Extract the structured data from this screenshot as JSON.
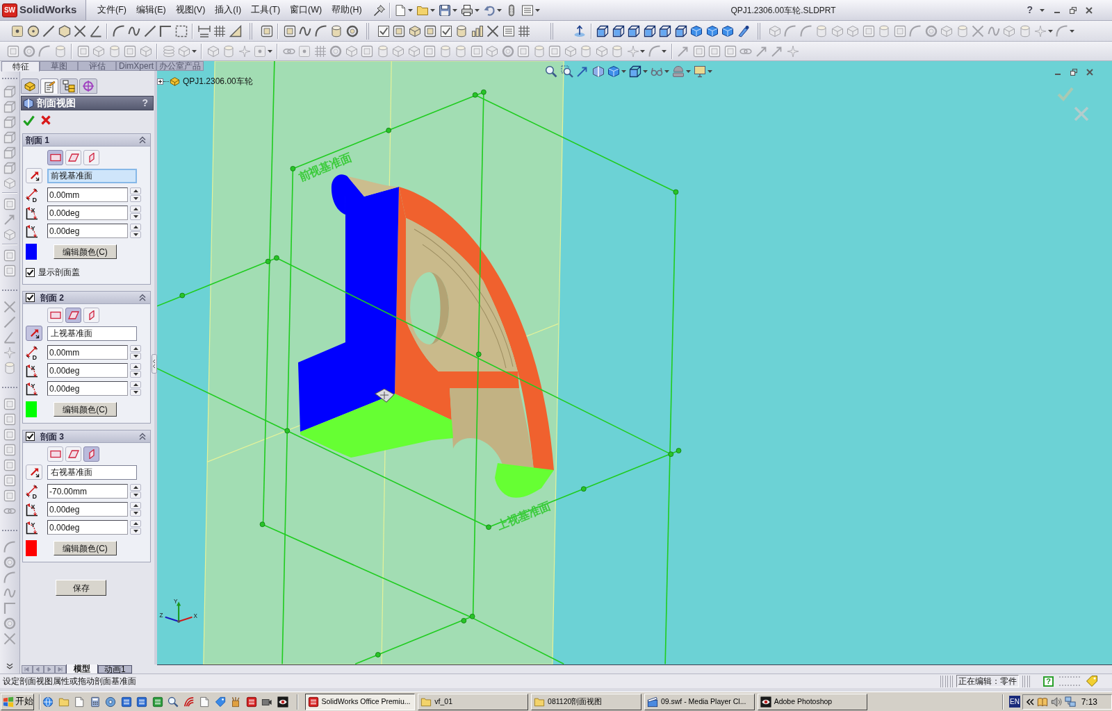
{
  "title_bar": {
    "logo_mark": "SW",
    "app_name": "SolidWorks",
    "menus": [
      "文件(F)",
      "编辑(E)",
      "视图(V)",
      "插入(I)",
      "工具(T)",
      "窗口(W)",
      "帮助(H)"
    ],
    "document_title": "QPJ1.2306.00车轮.SLDPRT",
    "help": "?"
  },
  "command_tabs": [
    {
      "label": "特征",
      "selected": true
    },
    {
      "label": "草图",
      "selected": false
    },
    {
      "label": "评估",
      "selected": false
    },
    {
      "label": "DimXpert",
      "selected": false
    },
    {
      "label": "办公室产品",
      "selected": false
    }
  ],
  "manager_tabs": [
    {
      "kind": "feature_tree",
      "selected": false
    },
    {
      "kind": "properties",
      "selected": true
    },
    {
      "kind": "configurations",
      "selected": false
    },
    {
      "kind": "dimxpert",
      "selected": false
    }
  ],
  "property_manager": {
    "title": "剖面视图",
    "help": "?",
    "sections": [
      {
        "kind": "plain",
        "title": "剖面 1",
        "planes": [
          {
            "kind": "front",
            "selected": true
          },
          {
            "kind": "top",
            "selected": false
          },
          {
            "kind": "right",
            "selected": false
          }
        ],
        "reversed": false,
        "reference": "前视基准面",
        "reference_active": true,
        "fields": [
          {
            "kind": "distance",
            "symbol": "D",
            "value": "0.00mm"
          },
          {
            "kind": "angle",
            "symbol": "X",
            "value": "0.00deg"
          },
          {
            "kind": "angle",
            "symbol": "Y",
            "value": "0.00deg"
          }
        ],
        "color": "#0000ff",
        "color_button": "编辑颜色(C)",
        "show_cap": {
          "label": "显示剖面盖",
          "checked": true
        }
      },
      {
        "kind": "checkable",
        "checked": true,
        "title": "剖面 2",
        "planes": [
          {
            "kind": "front",
            "selected": false
          },
          {
            "kind": "top",
            "selected": true
          },
          {
            "kind": "right",
            "selected": false
          }
        ],
        "reversed": true,
        "reference": "上视基准面",
        "reference_active": false,
        "fields": [
          {
            "kind": "distance",
            "symbol": "D",
            "value": "0.00mm"
          },
          {
            "kind": "angle",
            "symbol": "X",
            "value": "0.00deg"
          },
          {
            "kind": "angle",
            "symbol": "Y",
            "value": "0.00deg"
          }
        ],
        "color": "#00ff00",
        "color_button": "编辑颜色(C)"
      },
      {
        "kind": "checkable",
        "checked": true,
        "title": "剖面 3",
        "planes": [
          {
            "kind": "front",
            "selected": false
          },
          {
            "kind": "top",
            "selected": false
          },
          {
            "kind": "right",
            "selected": true
          }
        ],
        "reversed": false,
        "reference": "右视基准面",
        "reference_active": false,
        "fields": [
          {
            "kind": "distance",
            "symbol": "D",
            "value": "-70.00mm"
          },
          {
            "kind": "angle",
            "symbol": "X",
            "value": "0.00deg"
          },
          {
            "kind": "angle",
            "symbol": "Y",
            "value": "0.00deg"
          }
        ],
        "color": "#ff0000",
        "color_button": "编辑颜色(C)"
      }
    ],
    "save_button": "保存"
  },
  "feature_tree": {
    "root": "QPJ1.2306.00车轮",
    "expanded": false
  },
  "viewport": {
    "plane_labels": [
      "前视基准面",
      "上视基准面"
    ],
    "axis_labels": [
      "Y",
      "Z",
      "X"
    ]
  },
  "model_tabs": [
    {
      "label": "模型",
      "selected": true
    },
    {
      "label": "动画1",
      "selected": false
    }
  ],
  "status_bar": {
    "message": "设定剖面视图属性或拖动剖面基准面",
    "mode": "正在编辑：零件",
    "help": "?"
  },
  "taskbar": {
    "start": "开始",
    "tasks": [
      {
        "kind": "solidworks",
        "label": "SolidWorks Office Premiu...",
        "selected": true
      },
      {
        "kind": "folder",
        "label": "vf_01",
        "selected": false
      },
      {
        "kind": "folder",
        "label": "081120剖面视图",
        "selected": false
      },
      {
        "kind": "media",
        "label": "09.swf - Media Player Cl...",
        "selected": false
      },
      {
        "kind": "photoshop",
        "label": "Adobe Photoshop",
        "selected": false
      }
    ],
    "language": "EN",
    "clock": "7:13"
  }
}
